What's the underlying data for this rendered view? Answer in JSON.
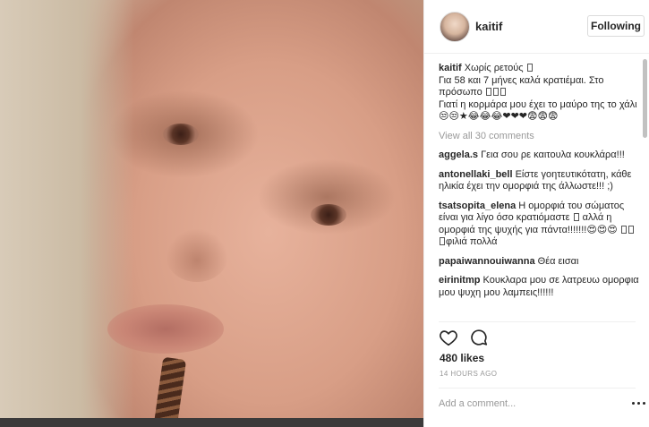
{
  "post": {
    "username": "kaitif",
    "follow_label": "Following",
    "caption_user": "kaitif",
    "caption_lines": [
      "Χωρίς ρετούς",
      "Για 58 και 7 μήνες καλά κρατιέμαι. Στο πρόσωπο",
      "Γιατί η κορμάρα μου έχει το μαύρο της το χάλι😒😒★😂😂😂❤❤❤😨😨😨"
    ],
    "view_all": "View all 30 comments",
    "comments": [
      {
        "user": "aggela.s",
        "text": "Γεια σου ρε καιτουλα κουκλάρα!!!"
      },
      {
        "user": "antonellaki_bell",
        "text": "Είστε γοητευτικότατη, κάθε ηλικία έχει την ομορφιά της άλλωστε!!! ;)"
      },
      {
        "user": "tsatsopita_elena",
        "text": "Η ομορφιά του σώματος είναι για λίγο όσο κρατιόμαστε",
        "text2": "αλλά η ομορφιά της ψυχής για πάντα!!!!!!!😍😍😍",
        "text3": "φιλιά πολλά"
      },
      {
        "user": "papaiwannouiwanna",
        "text": "Θέα εισαι"
      },
      {
        "user": "eirinitmp",
        "text": "Κουκλαρα μου σε λατρευω ομορφια μου ψυχη μου λαμπεις!!!!!!"
      }
    ],
    "likes": "480 likes",
    "time": "14 HOURS AGO",
    "add_comment_placeholder": "Add a comment..."
  },
  "icons": {
    "like": "heart-icon",
    "comment": "speech-bubble-icon",
    "more": "ellipsis-icon"
  },
  "colors": {
    "text": "#262626",
    "muted": "#999999",
    "border": "#efefef"
  }
}
